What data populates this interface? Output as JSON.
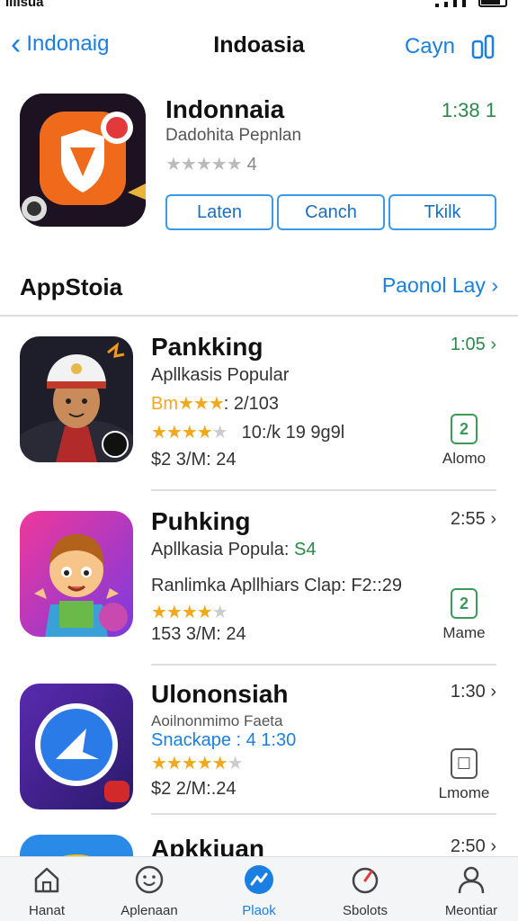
{
  "status": {
    "carrier": "IIIIsua"
  },
  "nav": {
    "back_label": "Indonaig",
    "title": "Indoasia",
    "right_label": "Cayn"
  },
  "hero": {
    "name": "Indonnaia",
    "subtitle": "Dadohita Pepnlan",
    "rating_count": "4",
    "time": "1:38 1",
    "buttons": [
      "Laten",
      "Canch",
      "Tkilk"
    ]
  },
  "section": {
    "title": "AppStoia",
    "link": "Paonol Lay"
  },
  "apps": [
    {
      "name": "Pankking",
      "subtitle": "Apllkasis Popular",
      "line3_prefix": "Bm",
      "line3_stars": "★★★",
      "line3_text": ": 2/103",
      "line4_text": "10:/k 19 9g9l",
      "line5": "$2 3/M: 24",
      "time": "1:05",
      "action_label": "Alomo",
      "action_glyph": "2"
    },
    {
      "name": "Puhking",
      "subtitle": "Apllkasia Popula:",
      "subtitle_accent": "S4",
      "line3_text": "Ranlimka Apllhiars Clap: F2::29",
      "line5": "153 3/M: 24",
      "time": "2:55",
      "action_label": "Mame",
      "action_glyph": "2"
    },
    {
      "name": "Ulononsiah",
      "subtitle": "Aoilnonmimo Faeta",
      "line3_text": "Snackape : 4 1:30",
      "line5": "$2 2/M:.24",
      "time": "1:30",
      "action_label": "Lmome",
      "action_glyph": "☐"
    },
    {
      "name": "Apkkiuan",
      "time": "2:50"
    }
  ],
  "tabs": [
    {
      "label": "Hanat",
      "icon": "home-icon"
    },
    {
      "label": "Aplenaan",
      "icon": "smiley-icon"
    },
    {
      "label": "Plaok",
      "icon": "bolt-icon",
      "active": true
    },
    {
      "label": "Sbolots",
      "icon": "gauge-icon"
    },
    {
      "label": "Meontiar",
      "icon": "person-icon"
    }
  ],
  "colors": {
    "accent": "#1a7fe0",
    "green": "#2a8a4a",
    "star": "#f2a81c"
  }
}
